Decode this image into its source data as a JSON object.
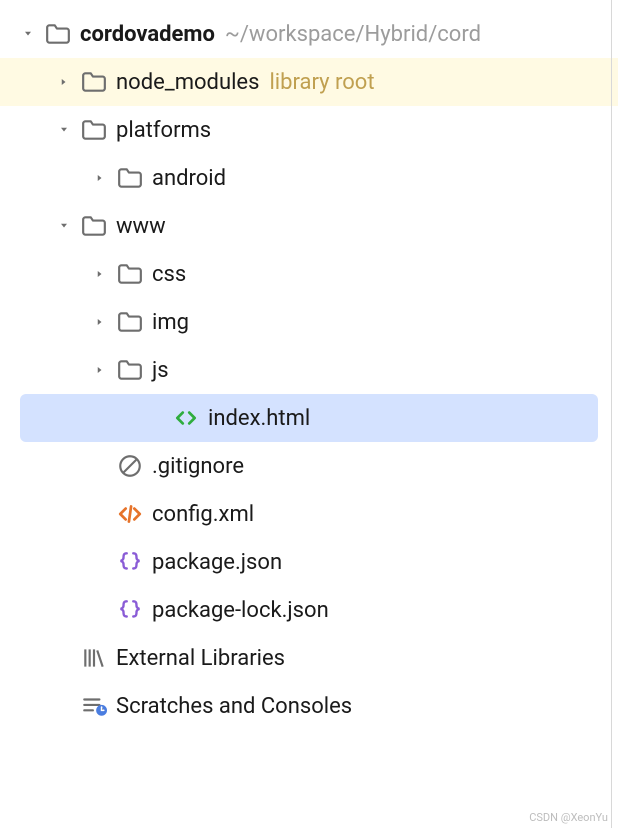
{
  "tree": {
    "root": {
      "name": "cordovademo",
      "path": "~/workspace/Hybrid/cord"
    },
    "node_modules": {
      "name": "node_modules",
      "suffix": "library root"
    },
    "platforms": {
      "name": "platforms"
    },
    "android": {
      "name": "android"
    },
    "www": {
      "name": "www"
    },
    "css": {
      "name": "css"
    },
    "img": {
      "name": "img"
    },
    "js": {
      "name": "js"
    },
    "index_html": {
      "name": "index.html"
    },
    "gitignore": {
      "name": ".gitignore"
    },
    "config_xml": {
      "name": "config.xml"
    },
    "package_json": {
      "name": "package.json"
    },
    "package_lock": {
      "name": "package-lock.json"
    },
    "external_libs": {
      "name": "External Libraries"
    },
    "scratches": {
      "name": "Scratches and Consoles"
    }
  },
  "watermark": "CSDN @XeonYu"
}
